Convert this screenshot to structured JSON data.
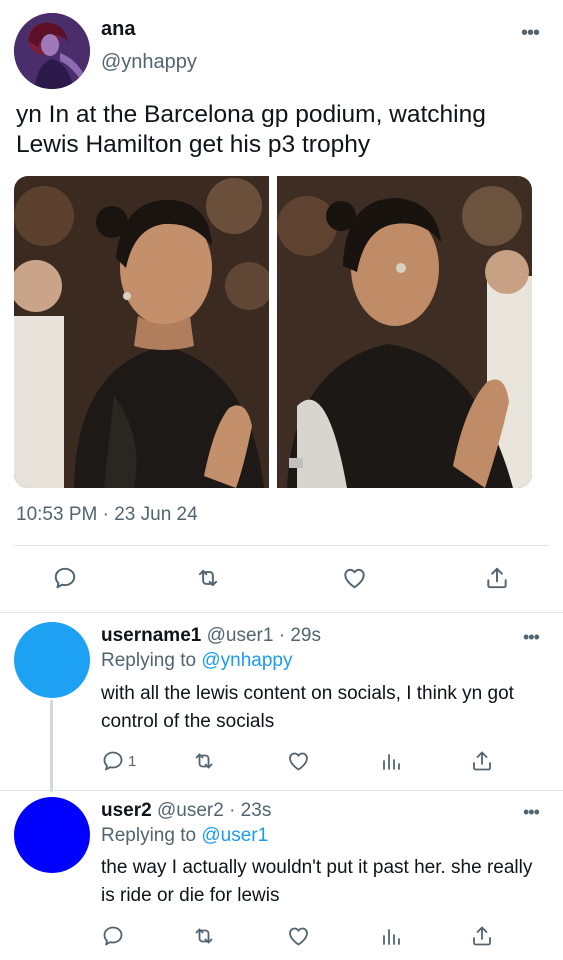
{
  "main_tweet": {
    "display_name": "ana",
    "handle": "@ynhappy",
    "more": "•••",
    "text": "yn In at the Barcelona gp podium, watching Lewis Hamilton get his p3 trophy",
    "timestamp": "10:53 PM · 23 Jun 24",
    "actions": [
      "reply-icon",
      "retweet-icon",
      "like-icon",
      "share-icon"
    ]
  },
  "replies": [
    {
      "display_name": "username1",
      "meta": "@user1 · 29s",
      "replying_label": "Replying to ",
      "replying_to": "@ynhappy",
      "text": "with all the lewis content on socials, I think yn got control of the socials",
      "reply_count": "1",
      "avatar_color": "#1da1f2",
      "more": "•••"
    },
    {
      "display_name": "user2",
      "meta": "@user2 · 23s",
      "replying_label": "Replying to ",
      "replying_to": "@user1",
      "text": "the way I actually wouldn't put it past her. she really is ride or die for lewis",
      "reply_count": "",
      "avatar_color": "#0000ff",
      "more": "•••"
    }
  ],
  "colors": {
    "accent": "#1d9bf0",
    "secondary_text": "#536471",
    "icon": "#536471"
  }
}
